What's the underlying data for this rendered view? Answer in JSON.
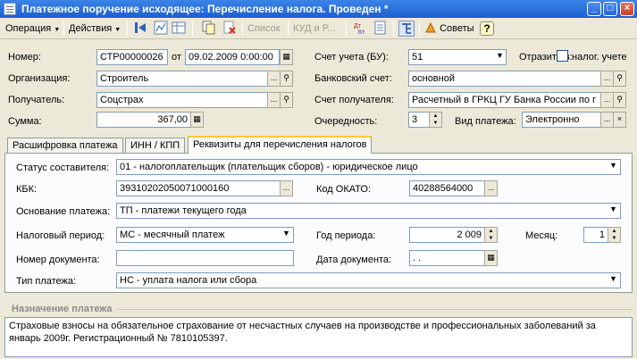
{
  "window": {
    "title": "Платежное поручение исходящее: Перечисление налога. Проведен *",
    "btn_min": "_",
    "btn_max": "□",
    "btn_close": "×"
  },
  "toolbar": {
    "operation": "Операция",
    "actions": "Действия",
    "list": "Список",
    "kud": "КУД и Р...",
    "tips": "Советы",
    "help": "?"
  },
  "header": {
    "number_label": "Номер:",
    "number_value": "СТР00000026",
    "date_from_label": "от",
    "date_value": "09.02.2009  0:00:00",
    "org_label": "Организация:",
    "org_value": "Строитель",
    "recipient_label": "Получатель:",
    "recipient_value": "Соцстрах",
    "sum_label": "Сумма:",
    "sum_value": "367,00",
    "account_bu_label": "Счет учета (БУ):",
    "account_bu_value": "51",
    "reflect_label": "Отразить в:",
    "tax_account_label": "налог. учете",
    "bank_account_label": "Банковский счет:",
    "bank_account_value": "основной",
    "recipient_account_label": "Счет получателя:",
    "recipient_account_value": "Расчетный в ГРКЦ ГУ Банка России по г",
    "priority_label": "Очередность:",
    "priority_value": "3",
    "payment_type_label": "Вид платежа:",
    "payment_type_value": "Электронно"
  },
  "tabs": [
    {
      "label": "Расшифровка платежа"
    },
    {
      "label": "ИНН / КПП"
    },
    {
      "label": "Реквизиты для перечисления налогов"
    }
  ],
  "tax": {
    "status_label": "Статус составителя:",
    "status_value": "01 - налогоплательщик (плательщик сборов) - юридическое лицо",
    "kbk_label": "КБК:",
    "kbk_value": "39310202050071000160",
    "okato_label": "Код ОКАТО:",
    "okato_value": "40288564000",
    "basis_label": "Основание платежа:",
    "basis_value": "ТП - платежи текущего года",
    "period_label": "Налоговый период:",
    "period_value": "МС - месячный платеж",
    "year_label": "Год периода:",
    "year_value": "2 009",
    "month_label": "Месяц:",
    "month_value": "1",
    "doc_number_label": "Номер документа:",
    "doc_number_value": "",
    "doc_date_label": "Дата документа:",
    "doc_date_value": " .  .",
    "pay_type_label": "Тип платежа:",
    "pay_type_value": "НС - уплата налога или сбора"
  },
  "purpose": {
    "title": "Назначение платежа",
    "text": "Страховые взносы на обязательное страхование от несчастных случаев на производстве и профессиональных заболеваний за январь 2009г. Регистрационный № 7810105397."
  },
  "icons": {
    "dots": "...",
    "search": "⚲",
    "dropdown": "▼",
    "clear": "×",
    "spin_up": "▲",
    "spin_down": "▼"
  }
}
